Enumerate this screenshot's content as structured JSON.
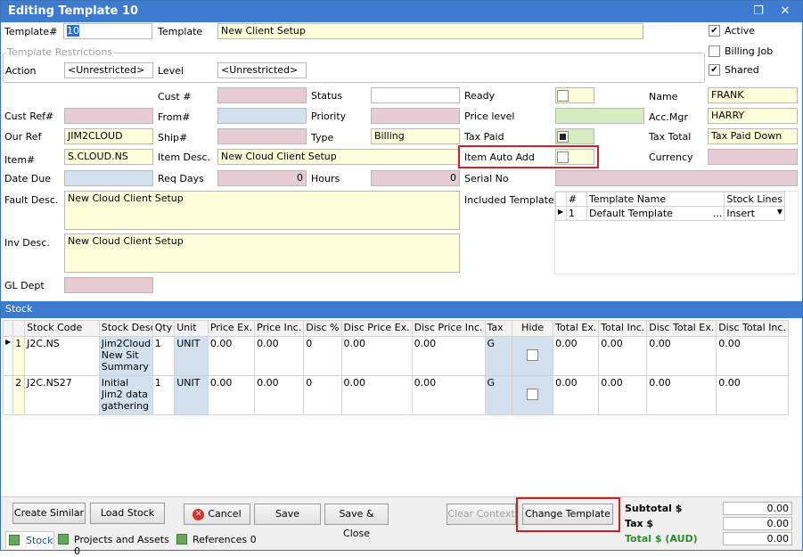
{
  "window": {
    "title": "Editing Template 10"
  },
  "header": {
    "template_num_label": "Template#",
    "template_num": "10",
    "template_label": "Template",
    "template": "New Client Setup",
    "active_label": "Active",
    "billing_job_label": "Billing Job",
    "shared_label": "Shared",
    "restrictions_label": "Template Restrictions",
    "action_label": "Action",
    "action": "<Unrestricted>",
    "level_label": "Level",
    "level": "<Unrestricted>"
  },
  "fields": {
    "cust_num_label": "Cust #",
    "status_label": "Status",
    "ready_label": "Ready",
    "name_label": "Name",
    "name": "FRANK",
    "cust_ref_label": "Cust Ref#",
    "from_label": "From#",
    "priority_label": "Priority",
    "price_level_label": "Price level",
    "acc_mgr_label": "Acc.Mgr",
    "acc_mgr": "HARRY",
    "our_ref_label": "Our Ref",
    "our_ref": "JIM2CLOUD",
    "ship_label": "Ship#",
    "type_label": "Type",
    "type": "Billing",
    "tax_paid_label": "Tax Paid",
    "tax_total_label": "Tax Total",
    "tax_total": "Tax Paid Down",
    "item_label": "Item#",
    "item": "S.CLOUD.NS",
    "item_desc_label": "Item Desc.",
    "item_desc": "New Cloud Client Setup",
    "item_auto_add_label": "Item Auto Add",
    "currency_label": "Currency",
    "date_due_label": "Date Due",
    "req_days_label": "Req Days",
    "req_days": "0",
    "hours_label": "Hours",
    "hours": "0",
    "serial_no_label": "Serial No",
    "fault_desc_label": "Fault Desc.",
    "fault_desc": "New Cloud Client Setup",
    "included_templates_label": "Included Templates",
    "inv_desc_label": "Inv Desc.",
    "inv_desc": "New Cloud Client Setup",
    "gl_dept_label": "GL Dept"
  },
  "included_templates": {
    "columns": [
      "#",
      "Template Name",
      "Stock Lines"
    ],
    "rows": [
      {
        "num": "1",
        "name": "Default Template",
        "more": "...",
        "stock_lines": "Insert"
      }
    ]
  },
  "stock": {
    "section_label": "Stock",
    "columns": [
      "Stock Code",
      "Stock Description",
      "Qty",
      "Unit",
      "Price Ex.",
      "Price Inc.",
      "Disc %",
      "Disc Price Ex.",
      "Disc Price Inc.",
      "Tax",
      "Hide",
      "Total Ex.",
      "Total Inc.",
      "Disc Total Ex.",
      "Disc Total Inc."
    ],
    "rows": [
      {
        "num": "1",
        "code": "J2C.NS",
        "desc": "Jim2Cloud New Sit Summary",
        "qty": "1",
        "unit": "UNIT",
        "price_ex": "0.00",
        "price_inc": "0.00",
        "disc": "0",
        "disc_price_ex": "0.00",
        "disc_price_inc": "0.00",
        "tax": "G",
        "total_ex": "0.00",
        "total_inc": "0.00",
        "disc_total_ex": "0.00",
        "disc_total_inc": "0.00"
      },
      {
        "num": "2",
        "code": "J2C.NS27",
        "desc": "Initial Jim2 data gathering",
        "qty": "1",
        "unit": "UNIT",
        "price_ex": "0.00",
        "price_inc": "0.00",
        "disc": "0",
        "disc_price_ex": "0.00",
        "disc_price_inc": "0.00",
        "tax": "G",
        "total_ex": "0.00",
        "total_inc": "0.00",
        "disc_total_ex": "0.00",
        "disc_total_inc": "0.00"
      }
    ]
  },
  "buttons": {
    "create_similar": "Create Similar",
    "load_stock": "Load Stock",
    "cancel": "Cancel",
    "save": "Save",
    "save_close": "Save & Close",
    "clear_context": "Clear Context",
    "change_template": "Change Template"
  },
  "tabs": {
    "stock": "Stock",
    "projects": "Projects and Assets 0",
    "references": "References 0"
  },
  "totals": {
    "subtotal_label": "Subtotal $",
    "subtotal": "0.00",
    "tax_label": "Tax $",
    "tax": "0.00",
    "total_label": "Total $ (AUD)",
    "total": "0.00"
  },
  "colors": {
    "title": "#3d7bd0",
    "highlight": "#d62020",
    "total_label": "#2e8b2e"
  }
}
